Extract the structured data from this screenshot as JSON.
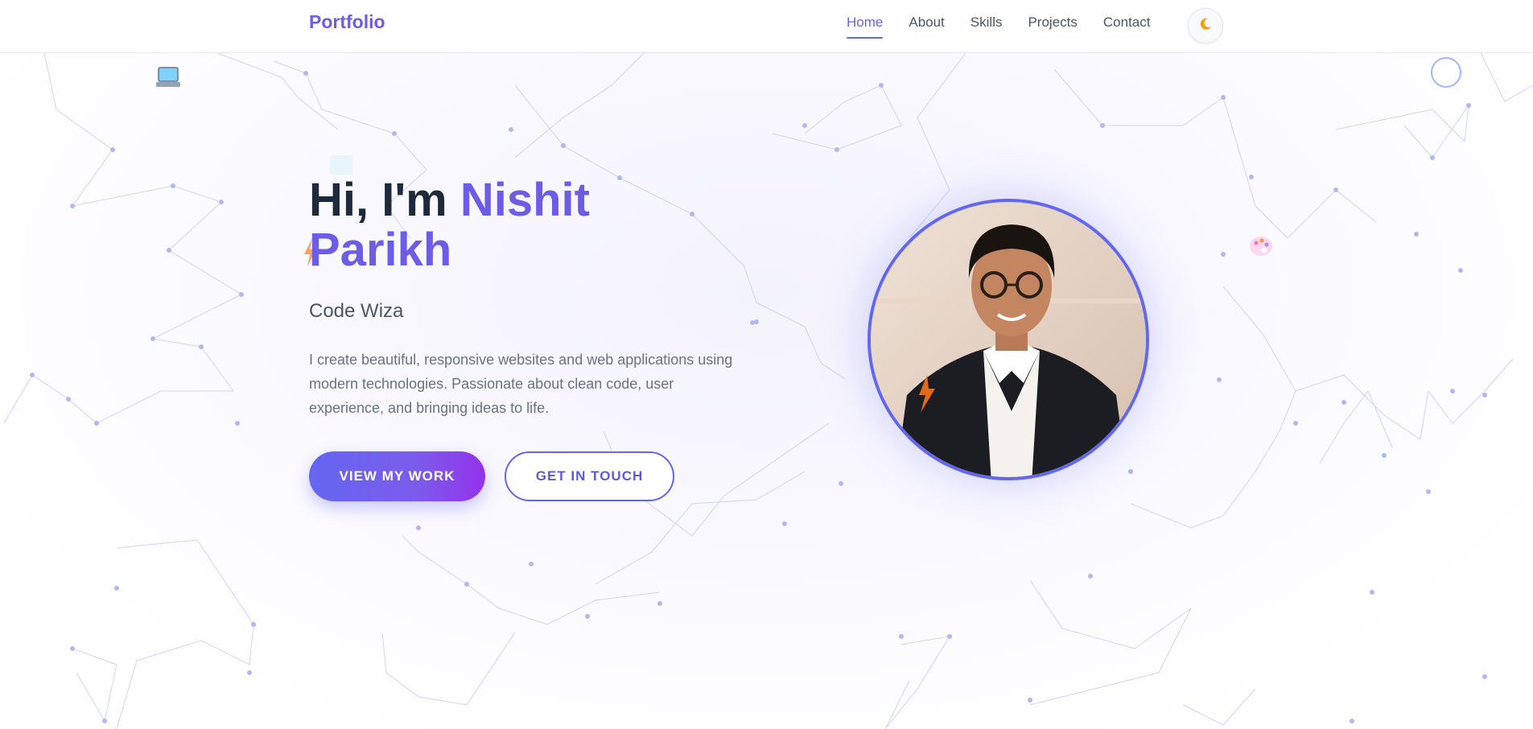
{
  "nav": {
    "brand": "Portfolio",
    "links": [
      {
        "label": "Home",
        "active": true
      },
      {
        "label": "About",
        "active": false
      },
      {
        "label": "Skills",
        "active": false
      },
      {
        "label": "Projects",
        "active": false
      },
      {
        "label": "Contact",
        "active": false
      }
    ],
    "theme_toggle_icon": "moon-icon"
  },
  "hero": {
    "greeting": "Hi, I'm ",
    "name_first": "Nishit",
    "name_last": "Parikh",
    "subtitle": "Code Wiza",
    "description": "I create beautiful, responsive websites and web applications using modern technologies. Passionate about clean code, user experience, and bringing ideas to life.",
    "primary_button": "VIEW MY WORK",
    "secondary_button": "GET IN TOUCH",
    "profile_image": "profile-photo"
  },
  "colors": {
    "accent": "#6366f1",
    "brand": "#6d5ce7",
    "text_dark": "#1e293b",
    "text_muted": "#6b7280"
  },
  "decorations": [
    "laptop-icon",
    "palette-icon",
    "lightning-icon",
    "circle-outline"
  ]
}
